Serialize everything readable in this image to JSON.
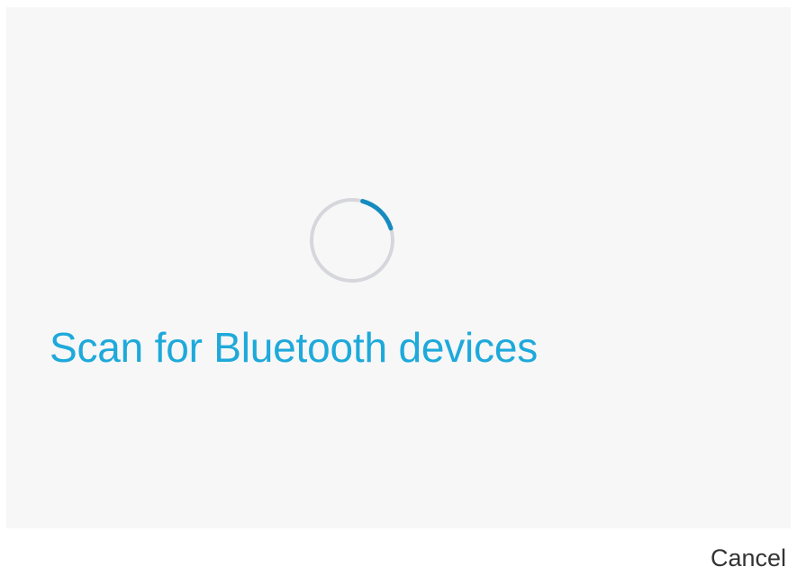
{
  "scan_panel": {
    "title": "Scan for Bluetooth devices",
    "spinner": {
      "icon": "loading-spinner-icon",
      "track_color": "#d6d7dc",
      "progress_color": "#168bc0",
      "progress_fraction": 0.16
    }
  },
  "footer": {
    "cancel_label": "Cancel"
  },
  "colors": {
    "accent": "#1ea9db",
    "text": "#333333",
    "panel_background": "#f7f7f7"
  }
}
